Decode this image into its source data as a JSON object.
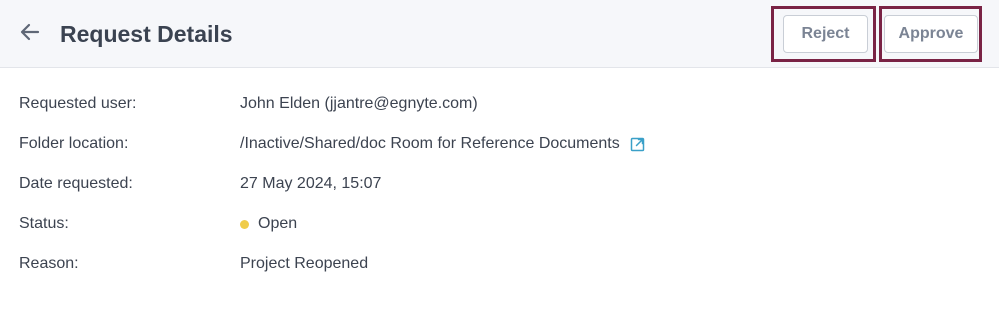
{
  "header": {
    "title": "Request Details",
    "back_icon": "arrow-left-icon",
    "reject_label": "Reject",
    "approve_label": "Approve"
  },
  "details": {
    "requested_user": {
      "label": "Requested user:",
      "value": "John Elden (jjantre@egnyte.com)"
    },
    "folder_location": {
      "label": "Folder location:",
      "value": "/Inactive/Shared/doc Room for Reference Documents",
      "icon": "external-link-icon"
    },
    "date_requested": {
      "label": "Date requested:",
      "value": "27 May 2024, 15:07"
    },
    "status": {
      "label": "Status:",
      "value": "Open",
      "dot_color": "#f0cc4a"
    },
    "reason": {
      "label": "Reason:",
      "value": "Project Reopened"
    }
  },
  "colors": {
    "highlight_border": "#7a2345",
    "link_icon": "#3aa0c8",
    "header_bg": "#f6f7fa"
  }
}
